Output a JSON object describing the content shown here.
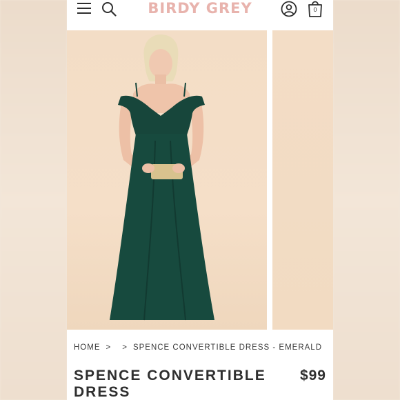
{
  "header": {
    "brand": "BIRDY GREY",
    "cart_count": "0",
    "icons": [
      "menu-icon",
      "search-icon",
      "account-icon",
      "cart-icon"
    ]
  },
  "breadcrumb": {
    "home": "HOME",
    "separator_1": ">",
    "separator_2": ">",
    "current": "SPENCE CONVERTIBLE DRESS - EMERALD"
  },
  "product": {
    "title": "SPENCE CONVERTIBLE DRESS",
    "price": "$99"
  },
  "colors": {
    "brand": "#e8b3ad",
    "dress": "#17463b",
    "backdrop": "#f3ddc6"
  }
}
